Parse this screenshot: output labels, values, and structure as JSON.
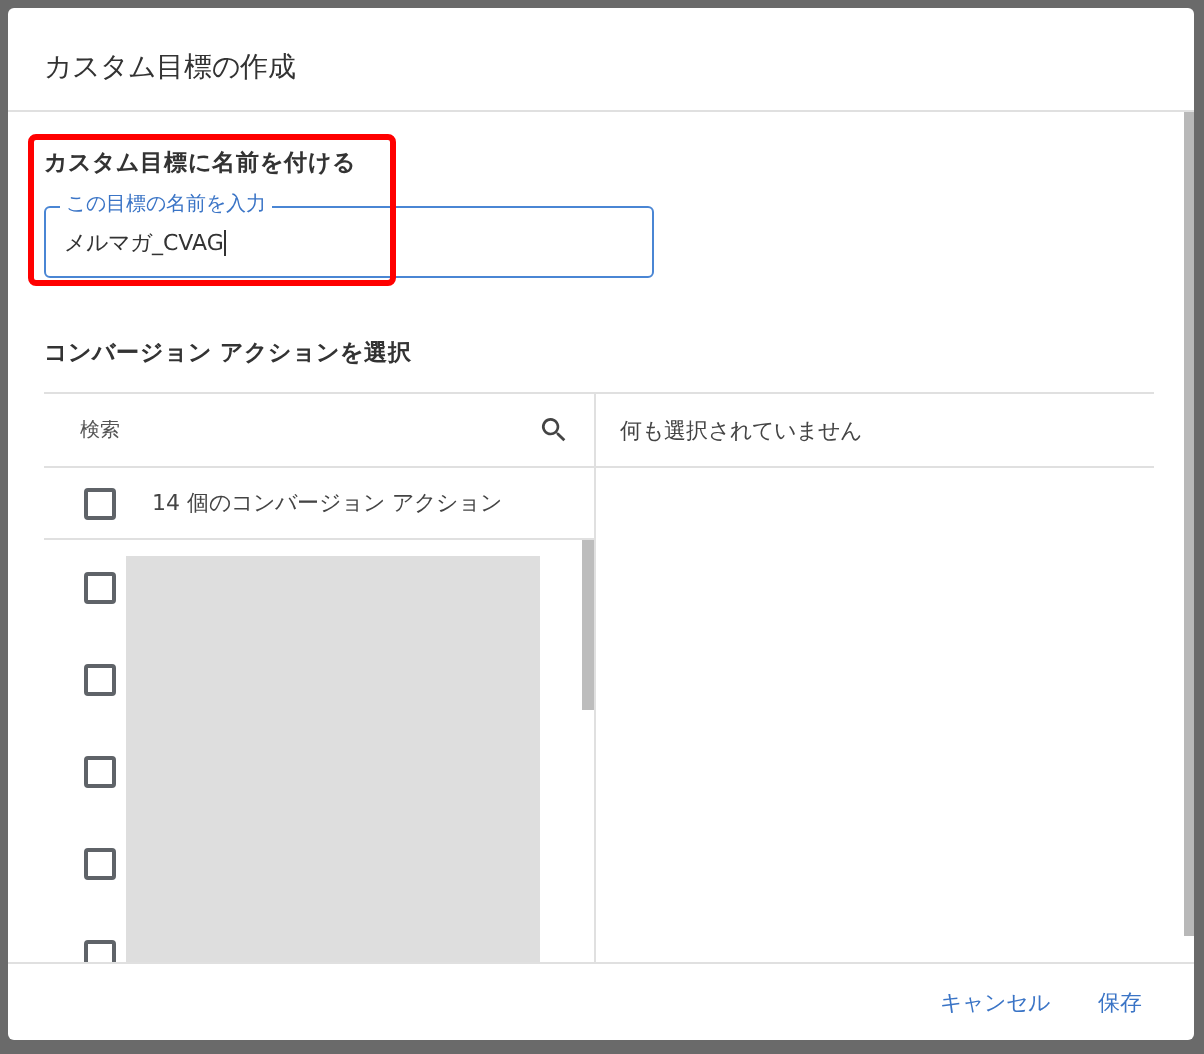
{
  "dialog": {
    "title": "カスタム目標の作成"
  },
  "name_section": {
    "heading": "カスタム目標に名前を付ける",
    "field": {
      "label": "この目標の名前を入力",
      "value": "メルマガ_CVAG"
    },
    "highlighted": true
  },
  "action_section": {
    "heading": "コンバージョン アクションを選択",
    "search": {
      "placeholder": "検索"
    },
    "select_all": {
      "label": "14 個のコンバージョン アクション",
      "checked": false
    },
    "items": [
      {
        "checked": false
      },
      {
        "checked": false
      },
      {
        "checked": false
      },
      {
        "checked": false
      },
      {
        "checked": false
      }
    ],
    "selected_panel": {
      "empty_text": "何も選択されていません"
    }
  },
  "buttons": [
    {
      "label": "キャンセル"
    },
    {
      "label": "保存"
    }
  ]
}
